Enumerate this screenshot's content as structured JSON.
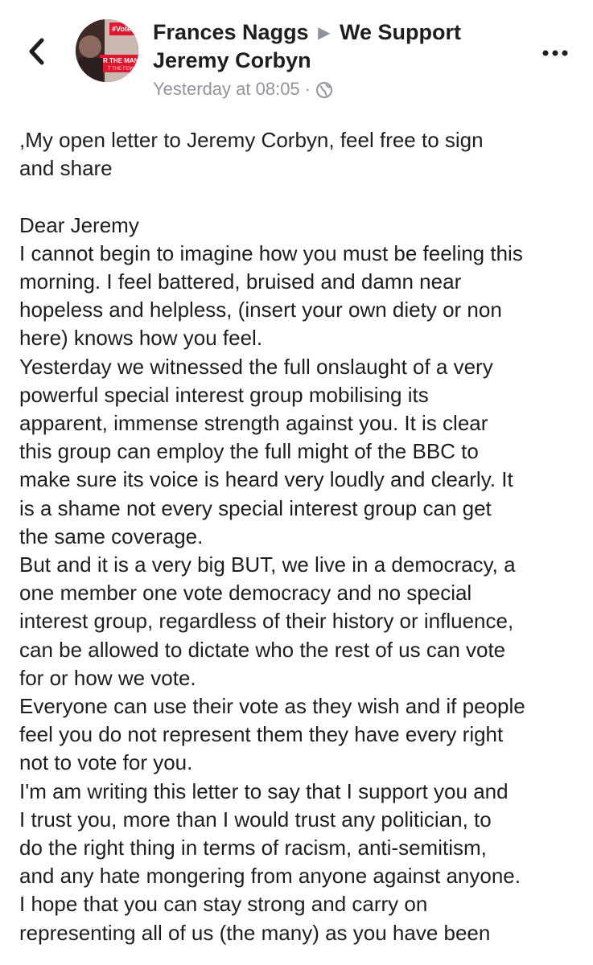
{
  "header": {
    "back_icon": "chevron-left-icon",
    "author": "Frances Naggs",
    "separator_icon": "right-triangle-icon",
    "group": "We Support Jeremy Corbyn",
    "timestamp": "Yesterday at 08:05",
    "separator_dot": "·",
    "privacy_icon": "globe-icon",
    "more_icon": "more-options-icon",
    "avatar_text_top": "#VoteLab",
    "avatar_text_mid": "R THE MANY",
    "avatar_text_bot": "T THE FEW"
  },
  "post": {
    "body": ",My open letter to Jeremy Corbyn, feel free to sign\nand share\n\nDear Jeremy\nI cannot begin to imagine how you must be feeling this\nmorning. I feel battered, bruised and damn near\nhopeless and helpless, (insert your own diety or non\nhere) knows how you feel.\nYesterday we witnessed the full onslaught of a very\npowerful special interest group mobilising its\napparent, immense strength against you. It is clear\nthis group can employ the full might of the BBC to\nmake sure its voice is heard very loudly and clearly. It\nis a shame not every special interest group can get\nthe same coverage.\nBut and it is a very big BUT, we live in a democracy, a\none member one vote democracy and no special\ninterest group, regardless of their history or influence,\ncan be allowed to dictate who the rest of us can vote\nfor or how we vote.\nEveryone can use their vote as they wish and if people\nfeel you do not represent them they have every right\nnot to vote for you.\nI'm am writing this letter to say that I support you and\nI trust you, more than I would trust any politician, to\ndo the right thing in terms of racism, anti-semitism,\nand any hate mongering from anyone against anyone.\nI hope that you can stay strong and carry on\nrepresenting all of us (the many) as you have been"
  }
}
